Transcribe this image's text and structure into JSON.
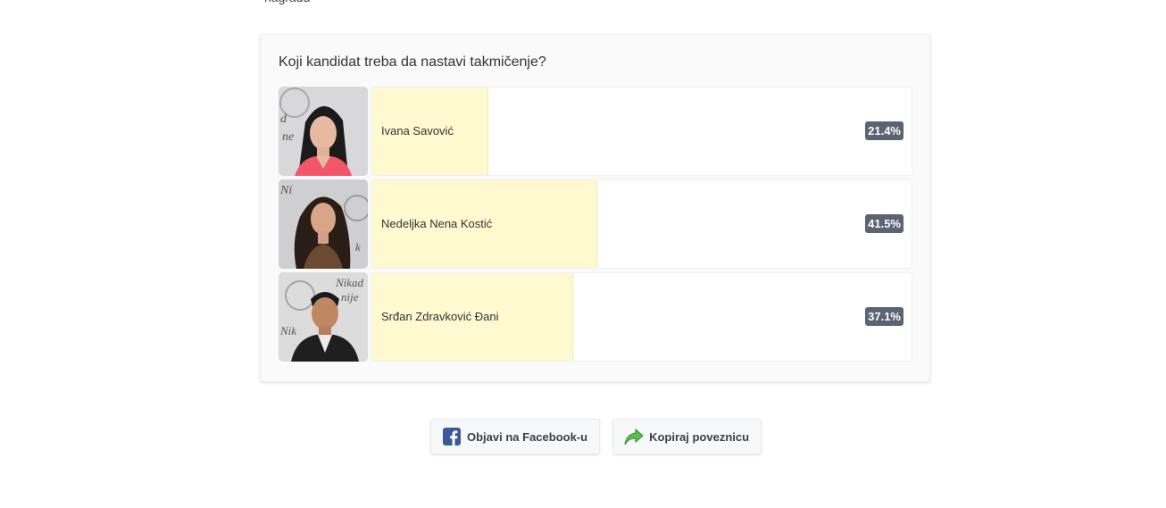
{
  "top_partial_text": "nagradu",
  "poll": {
    "question": "Koji kandidat treba da nastavi takmičenje?",
    "options": [
      {
        "name": "Ivana Savović",
        "percent_label": "21.4%",
        "percent": 21.4
      },
      {
        "name": "Nedeljka Nena Kostić",
        "percent_label": "41.5%",
        "percent": 41.5
      },
      {
        "name": "Srđan Zdravković Đani",
        "percent_label": "37.1%",
        "percent": 37.1
      }
    ]
  },
  "share": {
    "facebook_label": "Objavi na Facebook-u",
    "copy_label": "Kopiraj poveznicu"
  },
  "colors": {
    "bar_fill": "#fff9d0",
    "badge": "#5b6472",
    "facebook": "#3b5998",
    "share_arrow": "#4caf50"
  },
  "icons": {
    "facebook": "facebook-icon",
    "copy_link": "share-arrow-icon"
  }
}
